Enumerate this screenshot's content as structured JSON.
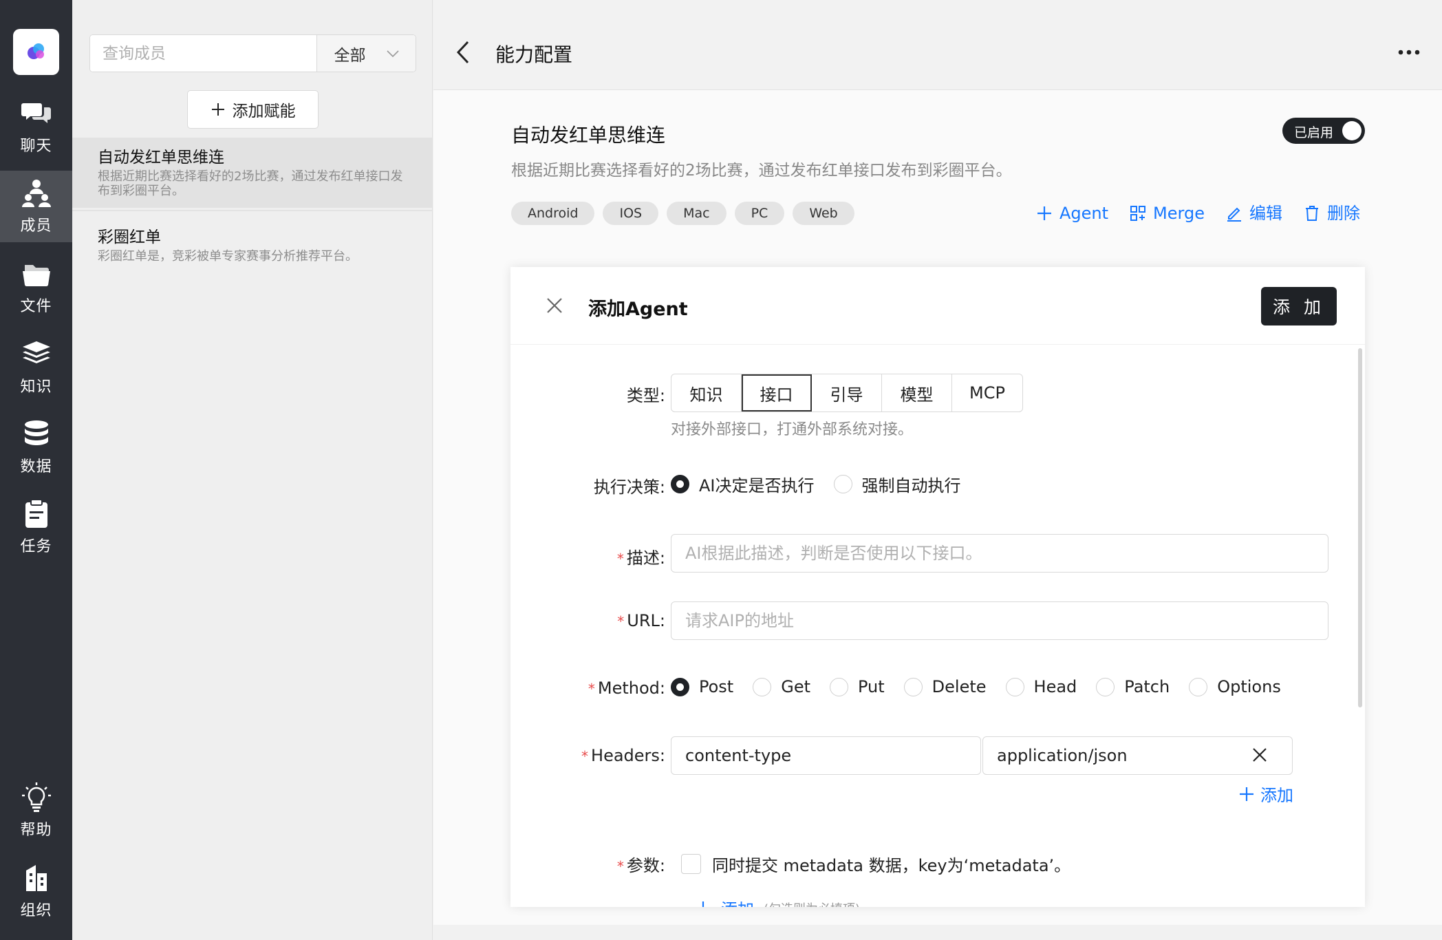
{
  "nav": {
    "items": [
      {
        "label": "聊天",
        "icon": "chat-icon"
      },
      {
        "label": "成员",
        "icon": "members-icon"
      },
      {
        "label": "文件",
        "icon": "folder-icon"
      },
      {
        "label": "知识",
        "icon": "knowledge-stack-icon"
      },
      {
        "label": "数据",
        "icon": "database-icon"
      },
      {
        "label": "任务",
        "icon": "clipboard-icon"
      },
      {
        "label": "帮助",
        "icon": "lightbulb-icon"
      },
      {
        "label": "组织",
        "icon": "building-icon"
      }
    ],
    "active": "成员"
  },
  "members": {
    "search_placeholder": "查询成员",
    "filter_value": "全部",
    "add_label": "添加赋能",
    "items": [
      {
        "name": "自动发红单思维连",
        "desc": "根据近期比赛选择看好的2场比赛，通过发布红单接口发布到彩圈平台。"
      },
      {
        "name": "彩圈红单",
        "desc": "彩圈红单是，竞彩被单专家赛事分析推荐平台。"
      }
    ]
  },
  "header": {
    "title": "能力配置"
  },
  "capability": {
    "title": "自动发红单思维连",
    "desc": "根据近期比赛选择看好的2场比赛，通过发布红单接口发布到彩圈平台。",
    "status_label": "已启用",
    "enabled": true,
    "tags": [
      "Android",
      "IOS",
      "Mac",
      "PC",
      "Web"
    ],
    "actions": {
      "agent": "Agent",
      "merge": "Merge",
      "edit": "编辑",
      "delete": "删除"
    }
  },
  "dialog": {
    "title": "添加Agent",
    "submit_label": "添 加",
    "type_label": "类型:",
    "types": [
      "知识",
      "接口",
      "引导",
      "模型",
      "MCP"
    ],
    "type_selected": "接口",
    "type_hint": "对接外部接口，打通外部系统对接。",
    "decision_label": "执行决策:",
    "decision_options": [
      "AI决定是否执行",
      "强制自动执行"
    ],
    "decision_selected": "AI决定是否执行",
    "required_mark": "*",
    "desc_label": "描述:",
    "desc_placeholder": "AI根据此描述，判断是否使用以下接口。",
    "url_label": "URL:",
    "url_placeholder": "请求AIP的地址",
    "method_label": "Method:",
    "methods": [
      "Post",
      "Get",
      "Put",
      "Delete",
      "Head",
      "Patch",
      "Options"
    ],
    "method_selected": "Post",
    "headers_label": "Headers:",
    "header_key": "content-type",
    "header_value": "application/json",
    "header_add": "添加",
    "params_label": "参数:",
    "params_checkbox": "同时提交 metadata 数据，key为‘metadata’。",
    "params_add": "添加",
    "params_add_note": "(勾选则为必填项)"
  },
  "colors": {
    "nav_bg": "#2c2f36",
    "accent_blue": "#1677ff",
    "dark_button": "#1f2226",
    "required_red": "#e84c4c"
  }
}
